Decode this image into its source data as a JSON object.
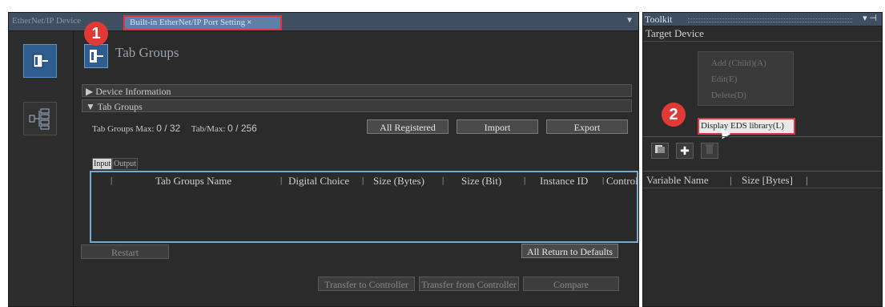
{
  "tabs": {
    "inactive_label": "EtherNet/IP Device",
    "active_label": "Built-in EtherNet/IP Port Setting",
    "close_glyph": "×",
    "dropdown_glyph": "▼"
  },
  "callouts": [
    "1",
    "2"
  ],
  "header": {
    "title": "Tab Groups"
  },
  "sections": {
    "device_info": "▶  Device Information",
    "tab_groups": "▼  Tab Groups"
  },
  "stats": {
    "tab_groups_label": "Tab Groups Max:",
    "tab_groups_value": "0  /  32",
    "tab_label": "Tab/Max:",
    "tab_value": "0  /  256"
  },
  "buttons": {
    "all_registered": "All Registered",
    "import": "Import",
    "export": "Export",
    "restart": "Restart",
    "all_return": "All Return to Defaults",
    "transfer_to": "Transfer to Controller",
    "transfer_from": "Transfer from Controller",
    "compare": "Compare"
  },
  "io_tabs": {
    "input": "Input",
    "output": "Output"
  },
  "table": {
    "columns": [
      "Tab Groups Name",
      "Digital Choice",
      "Size (Bytes)",
      "Size (Bit)",
      "Instance ID",
      "Control"
    ]
  },
  "toolkit": {
    "title": "Toolkit",
    "pin_glyph": "▾ ⊣",
    "target_device": "Target Device",
    "menu_items": [
      "Add (Child)(A)",
      "Edit(E)",
      "Delete(D)"
    ],
    "menu_highlight": "Display EDS library(L)",
    "icon_buttons": [
      "library-icon",
      "plus-icon",
      "trash-icon"
    ],
    "var_columns": [
      "Variable Name",
      "Size [Bytes]"
    ]
  },
  "colors": {
    "accent": "#2f5d8f",
    "callout": "#e03a36",
    "highlight_border": "#e0353a"
  }
}
